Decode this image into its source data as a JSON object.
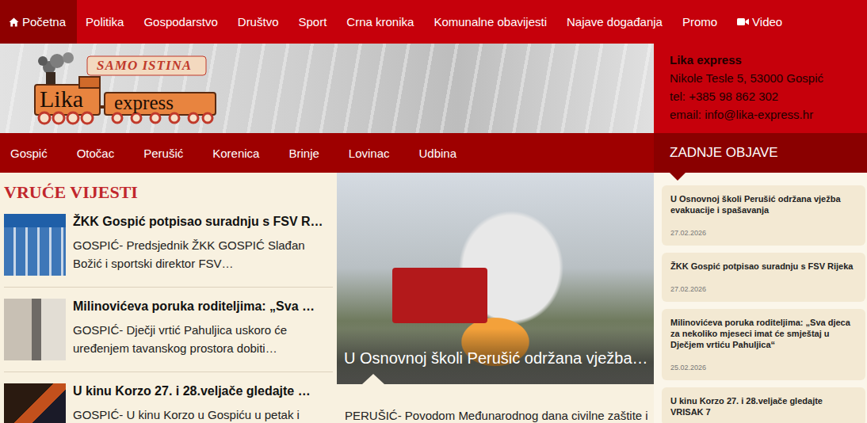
{
  "top_nav": [
    {
      "label": "Početna",
      "kind": "home",
      "selected": true
    },
    {
      "label": "Politika",
      "kind": "text",
      "selected": false
    },
    {
      "label": "Gospodarstvo",
      "kind": "text",
      "selected": false
    },
    {
      "label": "Društvo",
      "kind": "text",
      "selected": false
    },
    {
      "label": "Sport",
      "kind": "text",
      "selected": false
    },
    {
      "label": "Crna kronika",
      "kind": "text",
      "selected": false
    },
    {
      "label": "Komunalne obavijesti",
      "kind": "text",
      "selected": false
    },
    {
      "label": "Najave događanja",
      "kind": "text",
      "selected": false
    },
    {
      "label": "Promo",
      "kind": "text",
      "selected": false
    },
    {
      "label": "Video",
      "kind": "video",
      "selected": false
    }
  ],
  "logo": {
    "tagline": "SAMO ISTINA",
    "name_1": "Lika",
    "name_2": "express"
  },
  "contact": {
    "title": "Lika express",
    "address": "Nikole Tesle 5, 53000 Gospić",
    "phone": "tel: +385 98 862 302",
    "email": "email: info@lika-express.hr"
  },
  "city_nav": [
    "Gospić",
    "Otočac",
    "Perušić",
    "Korenica",
    "Brinje",
    "Lovinac",
    "Udbina"
  ],
  "hot_news": {
    "heading": "VRUĆE VIJESTI",
    "items": [
      {
        "title": "ŽKK Gospić potpisao suradnju s FSV R…",
        "excerpt": "GOSPIĆ- Predsjednik ŽKK GOSPIĆ Slađan Božić i sportski direktor FSV…"
      },
      {
        "title": "Milinovićeva poruka roditeljima: „Sva …",
        "excerpt": "GOSPIĆ- Dječji vrtić Pahuljica uskoro će uređenjem tavanskog prostora dobiti…"
      },
      {
        "title": "U kinu Korzo 27. i 28.veljače gledajte …",
        "excerpt": "GOSPIĆ- U kinu Korzo u Gospiću u petak i"
      }
    ]
  },
  "featured": {
    "title": "U Osnovnoj školi Perušić održana vježba…",
    "excerpt": "PERUŠIĆ- Povodom Međunarodnog dana civilne zaštite i"
  },
  "latest": {
    "heading": "ZADNJE OBJAVE",
    "items": [
      {
        "title": "U Osnovnoj školi Perušić održana vježba evakuacije i spašavanja",
        "date": "27.02.2026"
      },
      {
        "title": "ŽKK Gospić potpisao suradnju s FSV Rijeka",
        "date": "27.02.2026"
      },
      {
        "title": "Milinovićeva poruka roditeljima: „Sva djeca za nekoliko mjeseci imat će smještaj u Dječjem vrtiću Pahuljica“",
        "date": "25.02.2026"
      },
      {
        "title": "U kinu Korzo 27. i 28.veljače gledajte VRISAK 7"
      }
    ]
  }
}
